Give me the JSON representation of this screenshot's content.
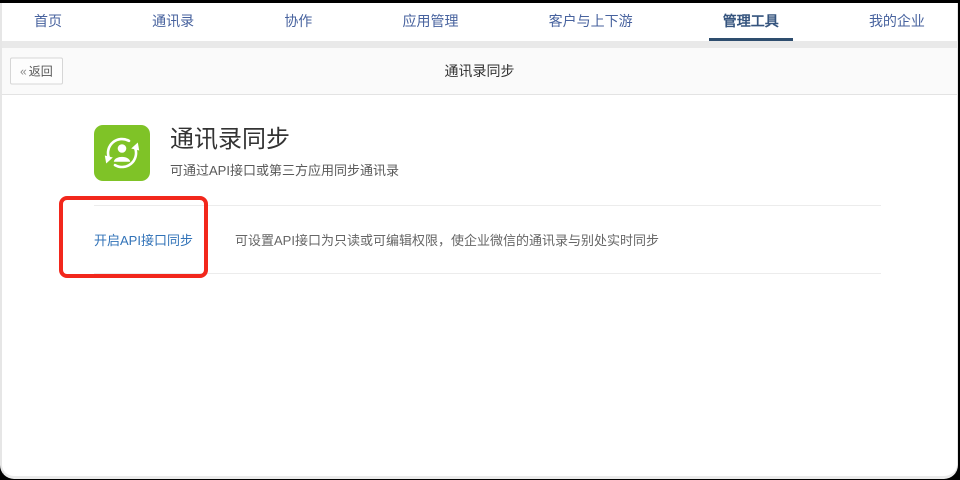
{
  "nav": {
    "items": [
      {
        "label": "首页",
        "active": false
      },
      {
        "label": "通讯录",
        "active": false
      },
      {
        "label": "协作",
        "active": false
      },
      {
        "label": "应用管理",
        "active": false
      },
      {
        "label": "客户与上下游",
        "active": false
      },
      {
        "label": "管理工具",
        "active": true
      },
      {
        "label": "我的企业",
        "active": false
      }
    ],
    "active_item": "管理工具"
  },
  "subheader": {
    "back_icon": "«",
    "back_label": "返回",
    "title": "通讯录同步"
  },
  "main": {
    "icon": "contact-sync-icon",
    "icon_bg_color": "#7fc327",
    "title": "通讯录同步",
    "subtitle": "可通过API接口或第三方应用同步通讯录",
    "section": {
      "link_label": "开启API接口同步",
      "description": "可设置API接口为只读或可编辑权限，使企业微信的通讯录与别处实时同步"
    }
  },
  "annotation": {
    "type": "highlight-box",
    "color": "#f2271c"
  },
  "colors": {
    "nav_link": "#47629e",
    "nav_active_underline": "#2e4d6e",
    "link_blue": "#3273b8",
    "icon_green": "#7fc327",
    "annotation_red": "#f2271c"
  }
}
